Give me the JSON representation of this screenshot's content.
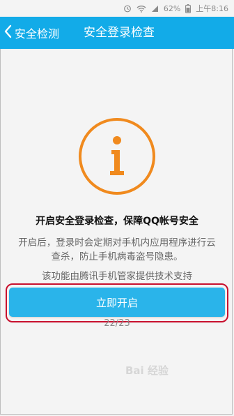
{
  "status_bar": {
    "battery_percent": "62%",
    "time": "上午8:16",
    "icons": [
      "alarm-icon",
      "wifi-icon",
      "signal-icon",
      "battery-icon"
    ]
  },
  "header": {
    "back_label": "安全检测",
    "title": "安全登录检查",
    "color": "#12abe8"
  },
  "main": {
    "icon": "info-icon",
    "icon_color": "#f08a1e",
    "heading": "开启安全登录检查，保障QQ帐号安全",
    "description": "开启后，登录时会定期对手机内应用程序进行云查杀，防止手机病毒盗号隐患。",
    "support_note": "该功能由腾讯手机管家提供技术支持",
    "enable_button": "立即开启",
    "pager": "22/23"
  },
  "watermark": {
    "text": "Bai 经验"
  }
}
